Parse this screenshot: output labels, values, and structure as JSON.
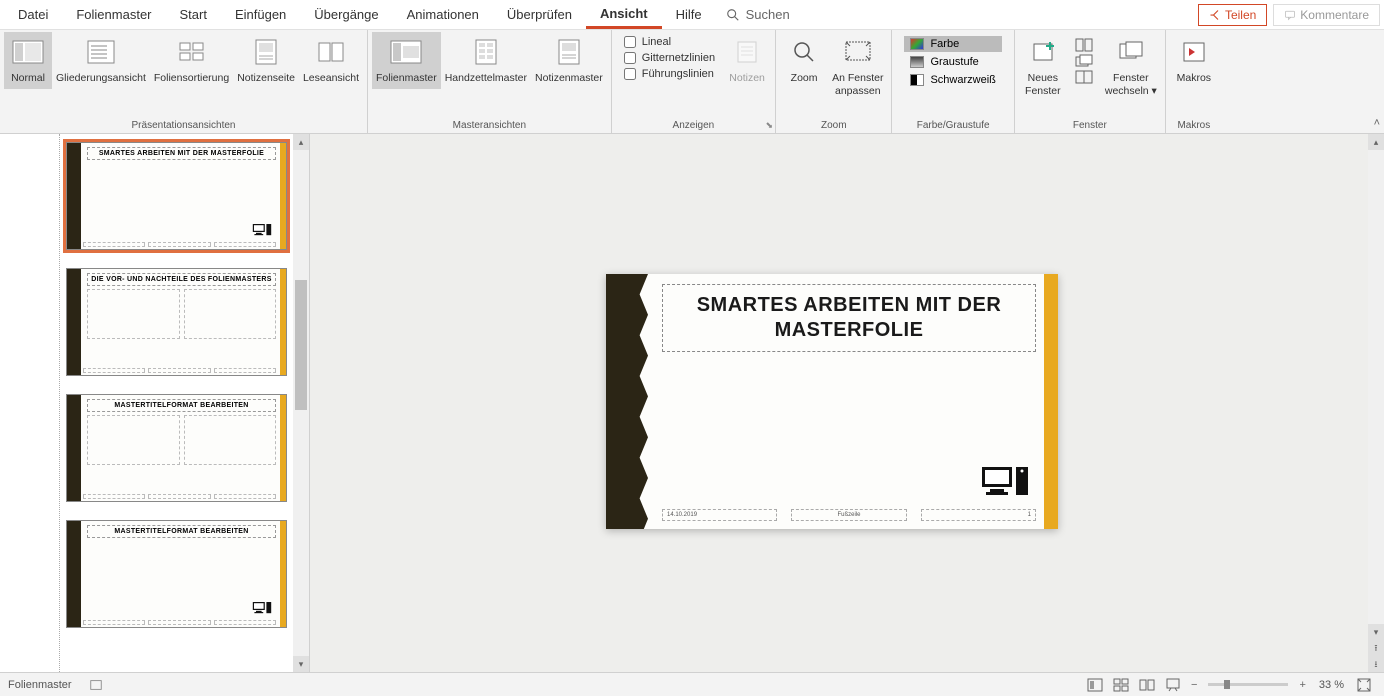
{
  "menu": {
    "items": [
      "Datei",
      "Folienmaster",
      "Start",
      "Einfügen",
      "Übergänge",
      "Animationen",
      "Überprüfen",
      "Ansicht",
      "Hilfe"
    ],
    "active_index": 7,
    "search_placeholder": "Suchen",
    "share_label": "Teilen",
    "comments_label": "Kommentare"
  },
  "ribbon": {
    "groups": {
      "presentation_views": {
        "label": "Präsentationsansichten",
        "items": [
          "Normal",
          "Gliederungsansicht",
          "Foliensortierung",
          "Notizenseite",
          "Leseansicht"
        ]
      },
      "master_views": {
        "label": "Masteransichten",
        "items": [
          "Folienmaster",
          "Handzettelmaster",
          "Notizenmaster"
        ],
        "active_index": 0
      },
      "show": {
        "label": "Anzeigen",
        "items": [
          "Lineal",
          "Gitternetzlinien",
          "Führungslinien"
        ],
        "notes_label": "Notizen"
      },
      "zoom": {
        "label": "Zoom",
        "zoom_label": "Zoom",
        "fit_label": "An Fenster\nanpassen"
      },
      "color": {
        "label": "Farbe/Graustufe",
        "items": [
          "Farbe",
          "Graustufe",
          "Schwarzweiß"
        ],
        "selected_index": 0
      },
      "window": {
        "label": "Fenster",
        "new_window_label": "Neues\nFenster",
        "switch_label": "Fenster\nwechseln"
      },
      "macros": {
        "label": "Makros",
        "macros_label": "Makros"
      }
    }
  },
  "thumbnails": [
    {
      "title": "SMARTES ARBEITEN MIT DER MASTERFOLIE",
      "selected": true,
      "layout": "title"
    },
    {
      "title": "DIE VOR- UND NACHTEILE DES FOLIENMASTERS",
      "selected": false,
      "layout": "twocol"
    },
    {
      "title": "MASTERTITELFORMAT BEARBEITEN",
      "selected": false,
      "layout": "twocol"
    },
    {
      "title": "MASTERTITELFORMAT BEARBEITEN",
      "selected": false,
      "layout": "title"
    }
  ],
  "slide": {
    "title": "SMARTES ARBEITEN MIT DER MASTERFOLIE",
    "date": "14.10.2019",
    "footer": "Fußzeile",
    "page": "1"
  },
  "statusbar": {
    "mode": "Folienmaster",
    "zoom": "33 %"
  }
}
